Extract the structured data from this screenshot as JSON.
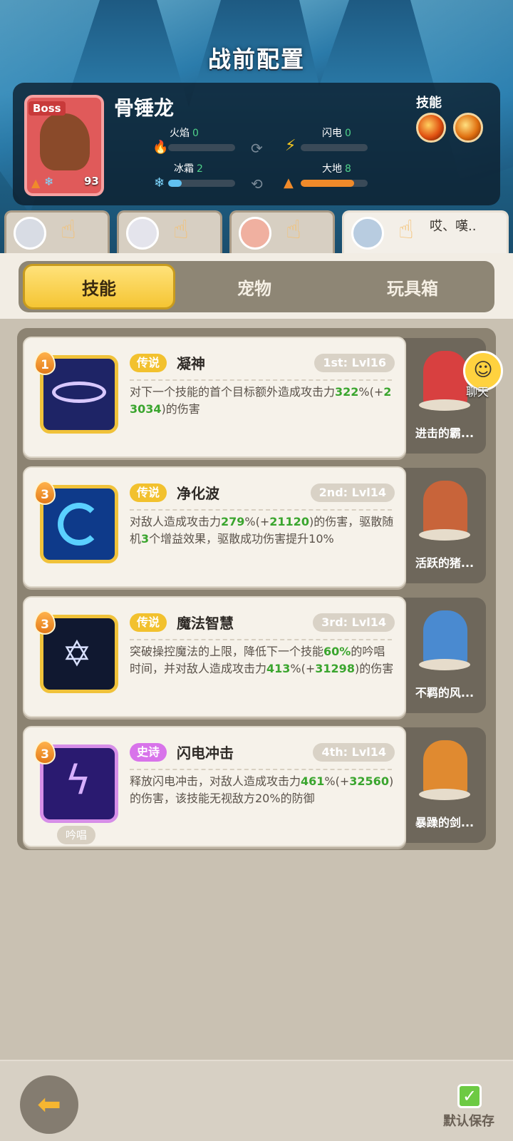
{
  "header": {
    "title": "战前配置"
  },
  "boss": {
    "tag": "Boss",
    "name": "骨锤龙",
    "level": "93",
    "resources": [
      {
        "label": "火焰",
        "value": "0",
        "fill": 0,
        "color": "#e04030",
        "icon": "flame-icon"
      },
      {
        "label": "闪电",
        "value": "0",
        "fill": 0,
        "color": "#f2c520",
        "icon": "lightning-icon"
      },
      {
        "label": "冰霜",
        "value": "2",
        "fill": 0.2,
        "color": "#60c0f0",
        "icon": "snowflake-icon"
      },
      {
        "label": "大地",
        "value": "8",
        "fill": 0.8,
        "color": "#f08a2a",
        "icon": "earth-icon"
      }
    ],
    "skills_label": "技能"
  },
  "heroes": [
    {
      "name": "hero-1",
      "active": false
    },
    {
      "name": "hero-2",
      "active": false
    },
    {
      "name": "hero-3",
      "active": false
    },
    {
      "name": "hero-4",
      "active": true,
      "chat": "哎、嘆.."
    }
  ],
  "tabs": {
    "skill": "技能",
    "pet": "宠物",
    "toybox": "玩具箱"
  },
  "cards": [
    {
      "level": "1",
      "rarity": "传说",
      "name": "凝神",
      "slot": "1st: Lvl16",
      "desc_parts": [
        "对下一个技能的首个目标额外造成攻击力",
        "322",
        "%(+",
        "23034",
        ")的伤害"
      ],
      "pet_name": "进击的霸..."
    },
    {
      "level": "3",
      "rarity": "传说",
      "name": "净化波",
      "slot": "2nd: Lvl14",
      "desc_parts": [
        "对敌人造成攻击力",
        "279",
        "%(+",
        "21120",
        ")的伤害，驱散随机",
        "3",
        "个增益效果，驱散成功伤害提升10%"
      ],
      "pet_name": "活跃的猪..."
    },
    {
      "level": "3",
      "rarity": "传说",
      "name": "魔法智慧",
      "slot": "3rd: Lvl14",
      "desc_parts": [
        "突破操控魔法的上限，降低下一个技能",
        "60%",
        "的吟唱时间，并对敌人造成攻击力",
        "413",
        "%(+",
        "31298",
        ")的伤害"
      ],
      "pet_name": "不羁的风..."
    },
    {
      "level": "3",
      "rarity": "史诗",
      "name": "闪电冲击",
      "slot": "4th: Lvl14",
      "desc_parts": [
        "释放闪电冲击，对敌人造成攻击力",
        "461",
        "%(+",
        "32560",
        ")的伤害，该技能无视敌方20%的防御"
      ],
      "chant": "吟唱",
      "pet_name": "暴躁的剑..."
    }
  ],
  "chat_float": {
    "label": "聊天"
  },
  "footer": {
    "save_label": "默认保存"
  }
}
